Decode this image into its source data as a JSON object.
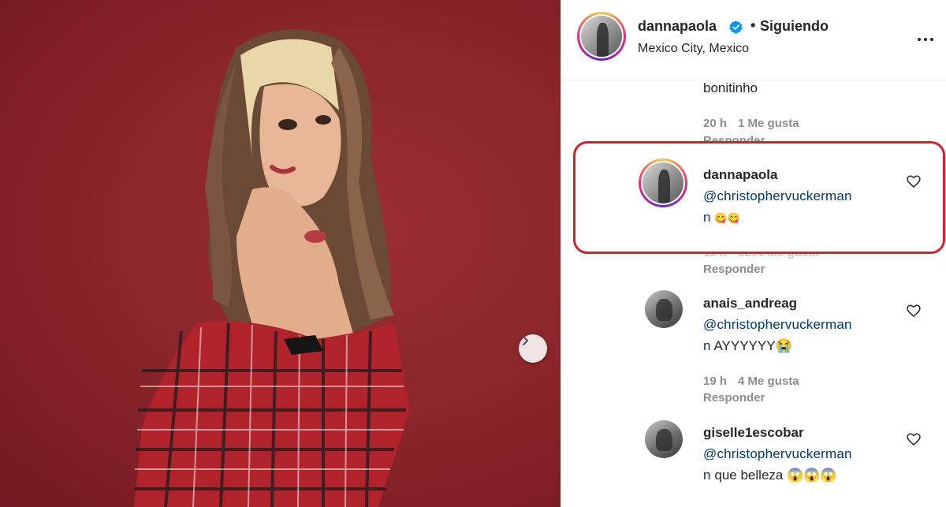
{
  "post": {
    "username": "dannapaola",
    "follow_label": "Siguiendo",
    "location": "Mexico City, Mexico",
    "separator": "•"
  },
  "comments": [
    {
      "username": "",
      "text": "bonitinho",
      "time": "20 h",
      "likes": "1 Me gusta",
      "reply": "Responder"
    },
    {
      "username": "dannapaola",
      "mention_line1": "@christophervuckerman",
      "mention_line2": "n",
      "text": "😋😋",
      "time": "19 h",
      "likes": "1256 Me gusta",
      "reply": "Responder"
    },
    {
      "username": "anais_andreag",
      "mention_line1": "@christophervuckerman",
      "mention_line2": "n",
      "text": "AYYYYYY😭",
      "time": "19 h",
      "likes": "4 Me gusta",
      "reply": "Responder"
    },
    {
      "username": "giselle1escobar",
      "mention_line1": "@christophervuckerman",
      "mention_line2": "n",
      "text": "que belleza 😱😱😱"
    }
  ],
  "colors": {
    "highlight": "#d2232a",
    "mention": "#00376b",
    "verified": "#0095f6",
    "photo_background": "#8b262c"
  },
  "icons": {
    "next": "chevron-right-icon",
    "more": "more-horizontal-icon",
    "like": "heart-outline-icon",
    "verified": "verified-badge-icon"
  }
}
